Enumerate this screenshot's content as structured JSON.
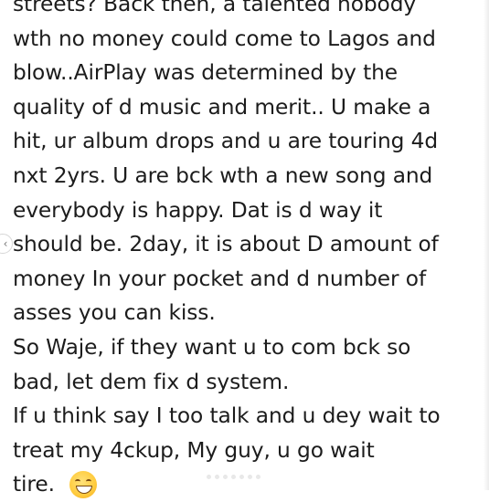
{
  "post": {
    "lines": [
      "streets? Back then, a talented nobody",
      "wth no money could come to Lagos and",
      "blow..AirPlay was determined by the",
      "quality of d music and merit.. U make a",
      "hit, ur album drops and u are touring 4d",
      "nxt 2yrs. U are bck wth a new song and",
      "everybody is happy. Dat is d way it",
      "should be. 2day, it is about D amount of",
      "money In your pocket and d number of",
      "asses you can kiss.",
      "So Waje, if they want u to com bck so",
      "bad, let dem fix d system.",
      "If u think say I too talk and u dey wait to",
      "treat my 4ckup, My guy, u go wait",
      "tire."
    ],
    "emoji": "grinning-face-emoji"
  },
  "carousel": {
    "prev_icon": "chevron-left-icon",
    "dots": 7
  }
}
